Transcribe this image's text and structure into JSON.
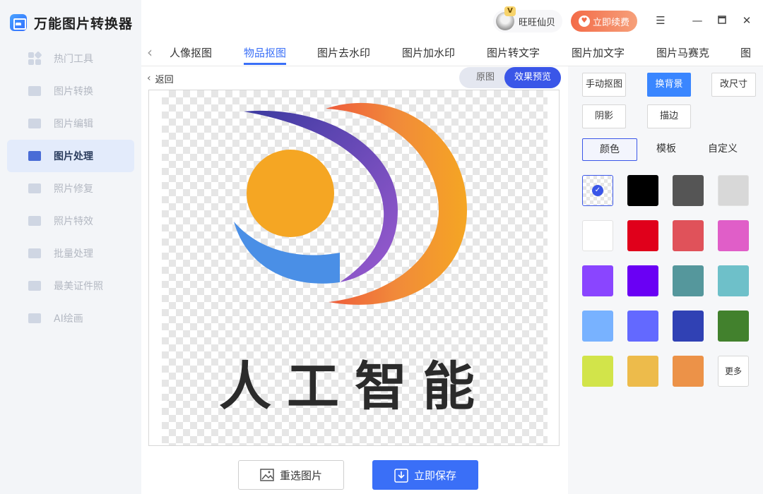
{
  "app": {
    "title": "万能图片转换器"
  },
  "sidebar": {
    "items": [
      {
        "label": "热门工具",
        "icon": "hot-tools-icon"
      },
      {
        "label": "图片转换",
        "icon": "image-convert-icon"
      },
      {
        "label": "图片编辑",
        "icon": "image-edit-icon"
      },
      {
        "label": "图片处理",
        "icon": "image-process-icon",
        "active": true
      },
      {
        "label": "照片修复",
        "icon": "photo-repair-icon"
      },
      {
        "label": "照片特效",
        "icon": "photo-effect-icon"
      },
      {
        "label": "批量处理",
        "icon": "batch-icon"
      },
      {
        "label": "最美证件照",
        "icon": "id-photo-icon"
      },
      {
        "label": "AI绘画",
        "icon": "ai-paint-icon"
      }
    ]
  },
  "header": {
    "user": {
      "name": "旺旺仙贝",
      "vip_badge": "V"
    },
    "renew_label": "立即续费"
  },
  "tabs": [
    {
      "label": "人像抠图"
    },
    {
      "label": "物品抠图",
      "active": true
    },
    {
      "label": "图片去水印"
    },
    {
      "label": "图片加水印"
    },
    {
      "label": "图片转文字"
    },
    {
      "label": "图片加文字"
    },
    {
      "label": "图片马赛克"
    },
    {
      "label": "图"
    }
  ],
  "preview": {
    "back_label": "返回",
    "toggle": {
      "original": "原图",
      "preview": "效果预览"
    },
    "image_text": "人工智能"
  },
  "actions": {
    "reselect": "重选图片",
    "save": "立即保存"
  },
  "right_panel": {
    "options": [
      {
        "label": "手动抠图"
      },
      {
        "label": "换背景",
        "active": true
      },
      {
        "label": "改尺寸"
      },
      {
        "label": "阴影"
      },
      {
        "label": "描边"
      }
    ],
    "subtabs": [
      {
        "label": "颜色",
        "active": true
      },
      {
        "label": "模板"
      },
      {
        "label": "自定义"
      }
    ],
    "colors": [
      "transparent",
      "#000000",
      "#555555",
      "#d8d8d8",
      "#ffffff",
      "#e0001b",
      "#e0525a",
      "#e05ec8",
      "#8a45ff",
      "#6a00f4",
      "#55979c",
      "#6ec0c9",
      "#78b2ff",
      "#6369ff",
      "#3041b4",
      "#42812d",
      "#d2e44a",
      "#edbb4b",
      "#ec9248"
    ],
    "more_label": "更多"
  },
  "accent": "#3a6ff7"
}
